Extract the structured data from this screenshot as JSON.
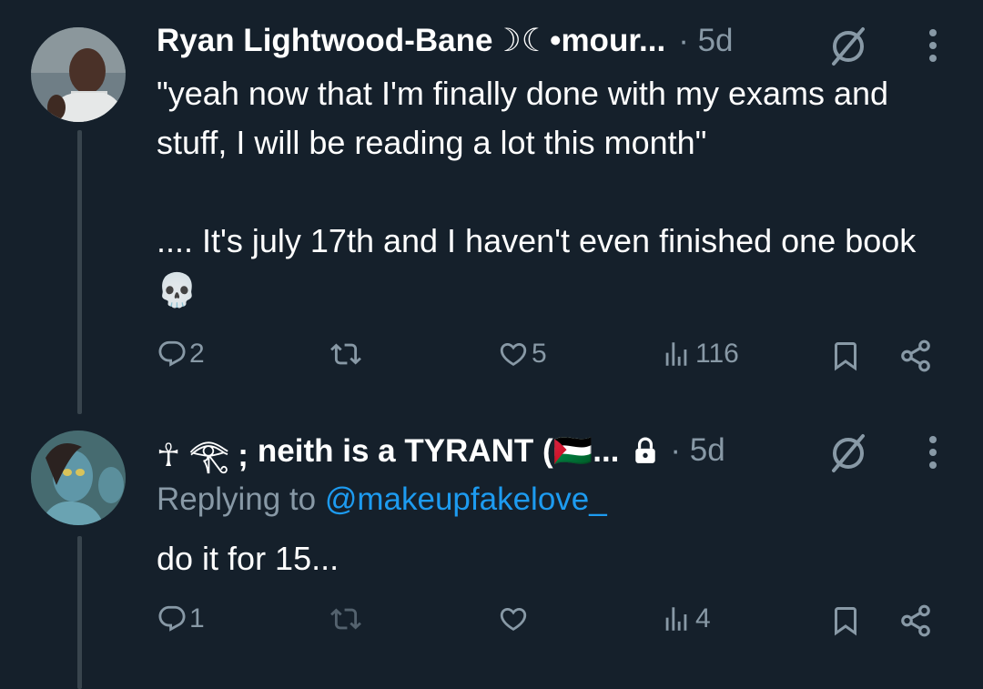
{
  "tweets": [
    {
      "name": "Ryan Lightwood-Bane☽☾•mour...",
      "time": "· 5d",
      "text": "\"yeah now that I'm finally done with my exams and stuff, I will be reading a lot this month\"\n\n.... It's july 17th and I haven't even finished one book 💀",
      "replies": "2",
      "retweets": "",
      "likes": "5",
      "views": "116"
    },
    {
      "name_prefix": "☥ 𓂀 ;",
      "name": "neith is a TYRANT (🇵🇸...",
      "time": "· 5d",
      "replying_label": "Replying to",
      "replying_handle": "@makeupfakelove_",
      "text": "do it for 15...",
      "replies": "1",
      "retweets": "",
      "likes": "",
      "views": "4"
    }
  ],
  "colors": {
    "background": "#15202b",
    "secondary_text": "#8899a6",
    "link": "#1d9bf0",
    "thread_line": "#38444d"
  },
  "icons": [
    "reply-icon",
    "retweet-icon",
    "like-icon",
    "views-icon",
    "bookmark-icon",
    "share-icon",
    "grok-slash-icon",
    "more-icon",
    "lock-icon"
  ]
}
